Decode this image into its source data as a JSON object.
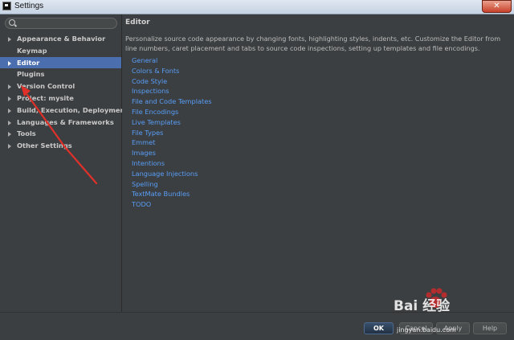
{
  "window": {
    "title": "Settings",
    "close_label": "✕"
  },
  "search": {
    "value": "",
    "placeholder": ""
  },
  "sidebar": {
    "items": [
      {
        "label": "Appearance & Behavior",
        "expandable": true,
        "selected": false
      },
      {
        "label": "Keymap",
        "expandable": false,
        "selected": false
      },
      {
        "label": "Editor",
        "expandable": true,
        "selected": true
      },
      {
        "label": "Plugins",
        "expandable": false,
        "selected": false
      },
      {
        "label": "Version Control",
        "expandable": true,
        "selected": false
      },
      {
        "label": "Project: mysite",
        "expandable": true,
        "selected": false
      },
      {
        "label": "Build, Execution, Deployment",
        "expandable": true,
        "selected": false
      },
      {
        "label": "Languages & Frameworks",
        "expandable": true,
        "selected": false
      },
      {
        "label": "Tools",
        "expandable": true,
        "selected": false
      },
      {
        "label": "Other Settings",
        "expandable": true,
        "selected": false
      }
    ]
  },
  "content": {
    "title": "Editor",
    "description": "Personalize source code appearance by changing fonts, highlighting styles, indents, etc. Customize the Editor from line numbers, caret placement and tabs to source code inspections, setting up templates and file encodings.",
    "links": [
      "General",
      "Colors & Fonts",
      "Code Style",
      "Inspections",
      "File and Code Templates",
      "File Encodings",
      "Live Templates",
      "File Types",
      "Emmet",
      "Images",
      "Intentions",
      "Language Injections",
      "Spelling",
      "TextMate Bundles",
      "TODO"
    ]
  },
  "footer": {
    "ok_label": "OK",
    "cancel_label": "Cancel",
    "apply_label": "Apply",
    "help_label": "Help"
  },
  "watermark": {
    "brand": "Bai  经验",
    "url": "jingyan.baidu.com"
  },
  "colors": {
    "background": "#3c3f41",
    "selection": "#4b6eaf",
    "link": "#589df6",
    "annotation_arrow": "#e0302a"
  }
}
